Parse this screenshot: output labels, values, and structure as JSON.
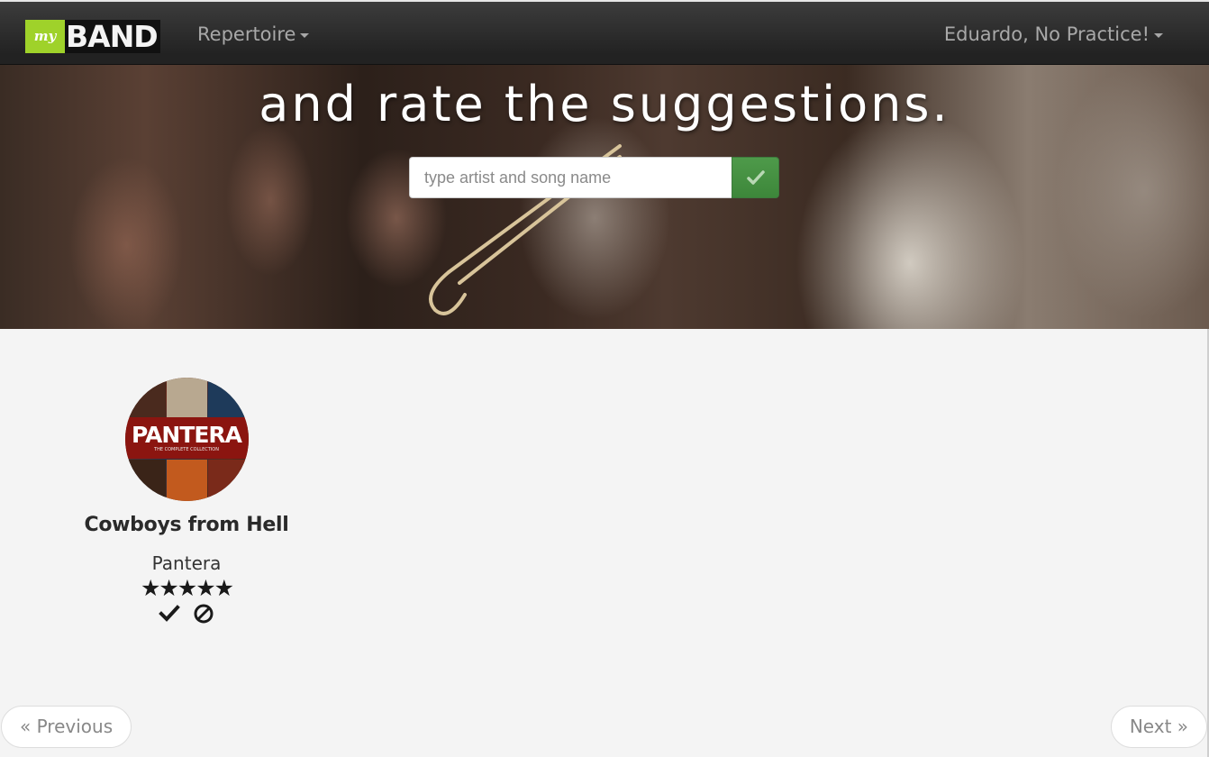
{
  "navbar": {
    "logo_my": "my",
    "logo_band": "BAND",
    "repertoire_label": "Repertoire",
    "user_label": "Eduardo, No Practice!"
  },
  "hero": {
    "heading": "and rate the suggestions.",
    "search_placeholder": "type artist and song name",
    "search_button_icon": "check-icon",
    "accent_color": "#459440"
  },
  "suggestions": [
    {
      "title": "Cowboys from Hell",
      "artist": "Pantera",
      "album_art_text": "PANTERA",
      "album_art_subtext": "THE COMPLETE COLLECTION",
      "rating": 5,
      "rating_max": 5,
      "rating_display": "★★★★★",
      "actions": [
        "accept-check-icon",
        "reject-ban-icon"
      ]
    }
  ],
  "pager": {
    "previous_label": "« Previous",
    "next_label": "Next »"
  }
}
